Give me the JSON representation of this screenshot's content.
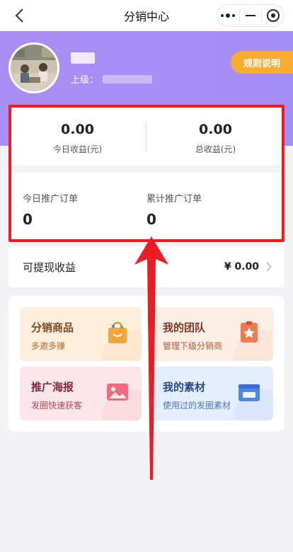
{
  "nav": {
    "title": "分销中心"
  },
  "header": {
    "user_name": "",
    "upline_label": "上级：",
    "rules_button": "规则说明"
  },
  "earnings": {
    "today_value": "0.00",
    "today_label": "今日收益(元)",
    "total_value": "0.00",
    "total_label": "总收益(元)"
  },
  "orders": {
    "today_label": "今日推广订单",
    "today_value": "0",
    "total_label": "累计推广订单",
    "total_value": "0"
  },
  "withdraw": {
    "label": "可提现收益",
    "value": "¥ 0.00"
  },
  "menu": [
    {
      "title": "分销商品",
      "subtitle": "多邀多赚",
      "icon": "shopping-bag-icon",
      "color": "#f6a43a"
    },
    {
      "title": "我的团队",
      "subtitle": "管理下级分销商",
      "icon": "badge-star-icon",
      "color": "#f07a4e"
    },
    {
      "title": "推广海报",
      "subtitle": "发圈快速获客",
      "icon": "image-icon",
      "color": "#f1687f"
    },
    {
      "title": "我的素材",
      "subtitle": "使用过的发圈素材",
      "icon": "folder-icon",
      "color": "#4c87ee"
    }
  ],
  "colors": {
    "header_bg": "#a98ef3",
    "rules_button": "#f6ac31",
    "highlight": "#ec1c24"
  }
}
